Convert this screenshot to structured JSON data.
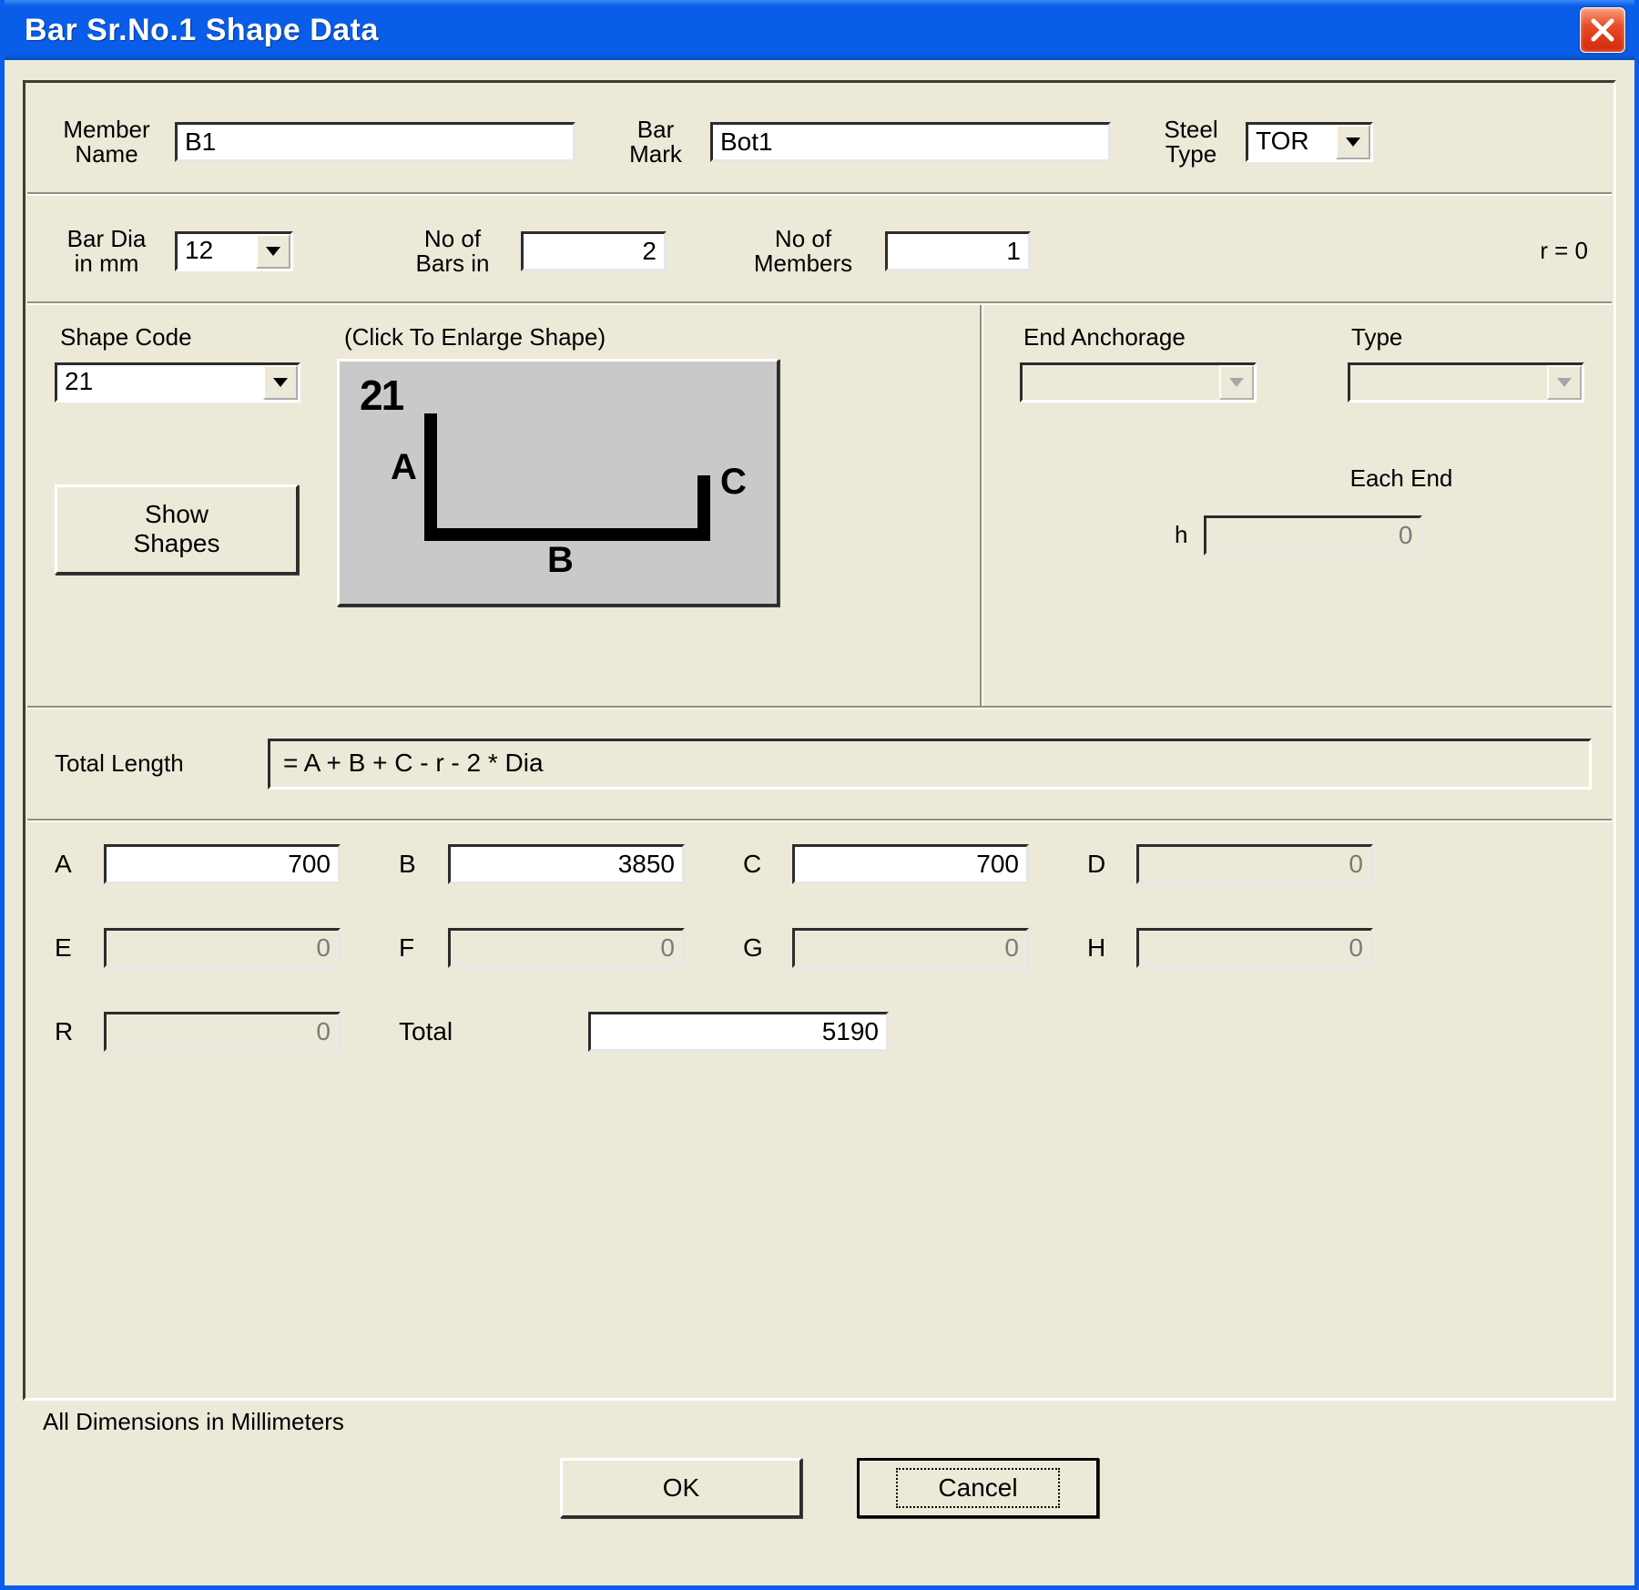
{
  "window": {
    "title": "Bar Sr.No.1 Shape Data"
  },
  "labels": {
    "member_name": "Member\nName",
    "bar_mark": "Bar\nMark",
    "steel_type": "Steel\nType",
    "bar_dia": "Bar Dia\nin mm",
    "no_of_bars": "No of\nBars in",
    "no_of_members": "No of\nMembers",
    "r_eq": "r  = 0",
    "shape_code": "Shape Code",
    "enlarge_hint": "(Click To Enlarge Shape)",
    "show_shapes": "Show\nShapes",
    "end_anchorage": "End Anchorage",
    "type": "Type",
    "each_end": "Each End",
    "h": "h",
    "total_length": "Total Length",
    "formula": "= A + B + C - r - 2 * Dia",
    "A": "A",
    "B": "B",
    "C": "C",
    "D": "D",
    "E": "E",
    "F": "F",
    "G": "G",
    "H": "H",
    "R": "R",
    "total": "Total",
    "disclaimer": "All Dimensions in Millimeters",
    "ok": "OK",
    "cancel": "Cancel"
  },
  "shape_preview": {
    "code": "21",
    "legA": "A",
    "legB": "B",
    "legC": "C"
  },
  "fields": {
    "member_name": "B1",
    "bar_mark": "Bot1",
    "steel_type": "TOR",
    "bar_dia": "12",
    "no_of_bars": "2",
    "no_of_members": "1",
    "shape_code": "21",
    "end_anchorage": "",
    "anchorage_type": "",
    "h": "0"
  },
  "dims": {
    "A": "700",
    "B": "3850",
    "C": "700",
    "D": "0",
    "E": "0",
    "F": "0",
    "G": "0",
    "H": "0",
    "R": "0",
    "Total": "5190"
  }
}
